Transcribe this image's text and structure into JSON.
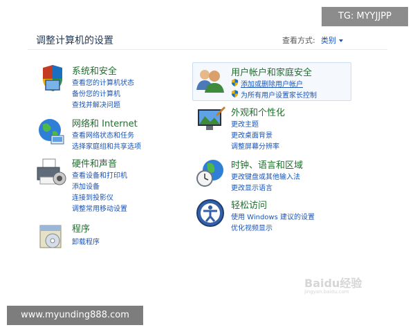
{
  "header": {
    "title": "调整计算机的设置",
    "view_by_label": "查看方式:",
    "view_by_value": "类别"
  },
  "categories": [
    {
      "id": "system-security",
      "title": "系统和安全",
      "links": [
        "查看您的计算机状态",
        "备份您的计算机",
        "查找并解决问题"
      ]
    },
    {
      "id": "network-internet",
      "title": "网络和 Internet",
      "links": [
        "查看网络状态和任务",
        "选择家庭组和共享选项"
      ]
    },
    {
      "id": "hardware-sound",
      "title": "硬件和声音",
      "links": [
        "查看设备和打印机",
        "添加设备",
        "连接到投影仪",
        "调整常用移动设置"
      ]
    },
    {
      "id": "programs",
      "title": "程序",
      "links": [
        "卸载程序"
      ]
    },
    {
      "id": "user-accounts",
      "title": "用户帐户和家庭安全",
      "links": [
        "添加或删除用户帐户",
        "为所有用户设置家长控制"
      ]
    },
    {
      "id": "appearance",
      "title": "外观和个性化",
      "links": [
        "更改主题",
        "更改桌面背景",
        "调整屏幕分辨率"
      ]
    },
    {
      "id": "clock-language-region",
      "title": "时钟、语言和区域",
      "links": [
        "更改键盘或其他输入法",
        "更改显示语言"
      ]
    },
    {
      "id": "ease-of-access",
      "title": "轻松访问",
      "links": [
        "使用 Windows 建议的设置",
        "优化视频显示"
      ]
    }
  ],
  "watermarks": {
    "tg": "TG: MYYJJPP",
    "url": "www.myunding888.com",
    "baidu": "Baidu经验",
    "baidu_sub": "jingyan.baidu.com"
  },
  "colors": {
    "category_title": "#1f6e2b",
    "link": "#1a55b8",
    "page_title": "#1e395b"
  }
}
